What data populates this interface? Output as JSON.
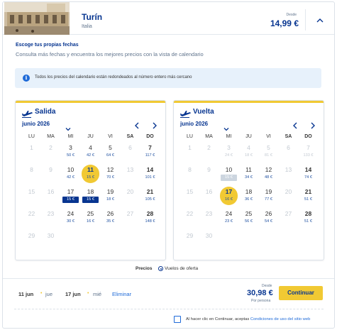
{
  "header": {
    "city": "Turín",
    "country": "Italia",
    "from_label": "Desde",
    "price": "14,99 €"
  },
  "title": "Escoge tus propias fechas",
  "subtitle": "Consulta más fechas y encuentra los mejores precios con la vista de calendario",
  "info_banner": "Todos los precios del calendario están redondeados al número entero más cercano",
  "weekdays": [
    "LU",
    "MA",
    "MI",
    "JU",
    "VI",
    "SA",
    "DO"
  ],
  "calendars": {
    "outbound": {
      "title": "Salida",
      "month": "junio 2026",
      "rows": [
        [
          {
            "day": "1",
            "s": "dis"
          },
          {
            "day": "2",
            "s": "dis"
          },
          {
            "day": "3",
            "price": "50 €"
          },
          {
            "day": "4",
            "price": "42 €"
          },
          {
            "day": "5",
            "price": "64 €"
          },
          {
            "day": "6",
            "s": "dis"
          },
          {
            "day": "7",
            "price": "117 €"
          }
        ],
        [
          {
            "day": "8",
            "s": "dis"
          },
          {
            "day": "9",
            "s": "dis"
          },
          {
            "day": "10",
            "price": "42 €"
          },
          {
            "day": "11",
            "price": "15 €",
            "s": "sel"
          },
          {
            "day": "12",
            "price": "70 €"
          },
          {
            "day": "13",
            "s": "dis"
          },
          {
            "day": "14",
            "price": "101 €"
          }
        ],
        [
          {
            "day": "15",
            "s": "dis"
          },
          {
            "day": "16",
            "s": "dis"
          },
          {
            "day": "17",
            "price": "15 €",
            "s": "low"
          },
          {
            "day": "18",
            "price": "15 €",
            "s": "low"
          },
          {
            "day": "19",
            "price": "18 €"
          },
          {
            "day": "20",
            "s": "dis"
          },
          {
            "day": "21",
            "price": "105 €"
          }
        ],
        [
          {
            "day": "22",
            "s": "dis"
          },
          {
            "day": "23",
            "s": "dis"
          },
          {
            "day": "24",
            "price": "30 €"
          },
          {
            "day": "25",
            "price": "16 €"
          },
          {
            "day": "26",
            "price": "35 €"
          },
          {
            "day": "27",
            "s": "dis"
          },
          {
            "day": "28",
            "price": "148 €"
          }
        ],
        [
          {
            "day": "29",
            "s": "dis"
          },
          {
            "day": "30",
            "s": "dis"
          }
        ]
      ]
    },
    "return": {
      "title": "Vuelta",
      "month": "junio 2026",
      "rows": [
        [
          {
            "day": "1",
            "s": "dis"
          },
          {
            "day": "2",
            "s": "dis"
          },
          {
            "day": "3",
            "price": "24 €",
            "s": "dis"
          },
          {
            "day": "4",
            "price": "18 €",
            "s": "dis"
          },
          {
            "day": "5",
            "price": "81 €",
            "s": "dis"
          },
          {
            "day": "6",
            "s": "dis"
          },
          {
            "day": "7",
            "price": "133 €",
            "s": "dis"
          }
        ],
        [
          {
            "day": "8",
            "s": "dis"
          },
          {
            "day": "9",
            "s": "dis"
          },
          {
            "day": "10",
            "price": "15 €",
            "s": "ghost"
          },
          {
            "day": "11",
            "price": "34 €"
          },
          {
            "day": "12",
            "price": "48 €"
          },
          {
            "day": "13",
            "s": "dis"
          },
          {
            "day": "14",
            "price": "74 €"
          }
        ],
        [
          {
            "day": "15",
            "s": "dis"
          },
          {
            "day": "16",
            "s": "dis"
          },
          {
            "day": "17",
            "price": "16 €",
            "s": "sel"
          },
          {
            "day": "18",
            "price": "36 €"
          },
          {
            "day": "19",
            "price": "77 €"
          },
          {
            "day": "20",
            "s": "dis"
          },
          {
            "day": "21",
            "price": "51 €"
          }
        ],
        [
          {
            "day": "22",
            "s": "dis"
          },
          {
            "day": "23",
            "s": "dis"
          },
          {
            "day": "24",
            "price": "23 €"
          },
          {
            "day": "25",
            "price": "56 €"
          },
          {
            "day": "26",
            "price": "54 €"
          },
          {
            "day": "27",
            "s": "dis"
          },
          {
            "day": "28",
            "price": "51 €"
          }
        ],
        [
          {
            "day": "29",
            "s": "dis"
          },
          {
            "day": "30",
            "s": "dis"
          }
        ]
      ]
    }
  },
  "legend": {
    "label": "Precios",
    "item": "Vuelos de oferta"
  },
  "footer": {
    "outbound_date": "11 jun",
    "outbound_dow": "jue",
    "return_date": "17 jun",
    "return_dow": "mié",
    "remove": "Eliminar",
    "from_label": "Desde",
    "total": "30,98 €",
    "per_person": "Por persona",
    "continue": "Continuar",
    "terms_prefix": "Al hacer clic en Continuar, aceptas",
    "terms_link": "Condiciones de uso del sitio web"
  },
  "colors": {
    "brand": "#073590",
    "accent": "#f1c933",
    "link": "#1e6ad8",
    "low_price_bg": "#073590"
  },
  "icons": {
    "info": "info-icon",
    "plane": "plane-icon",
    "collapse": "chevron-up-icon"
  }
}
